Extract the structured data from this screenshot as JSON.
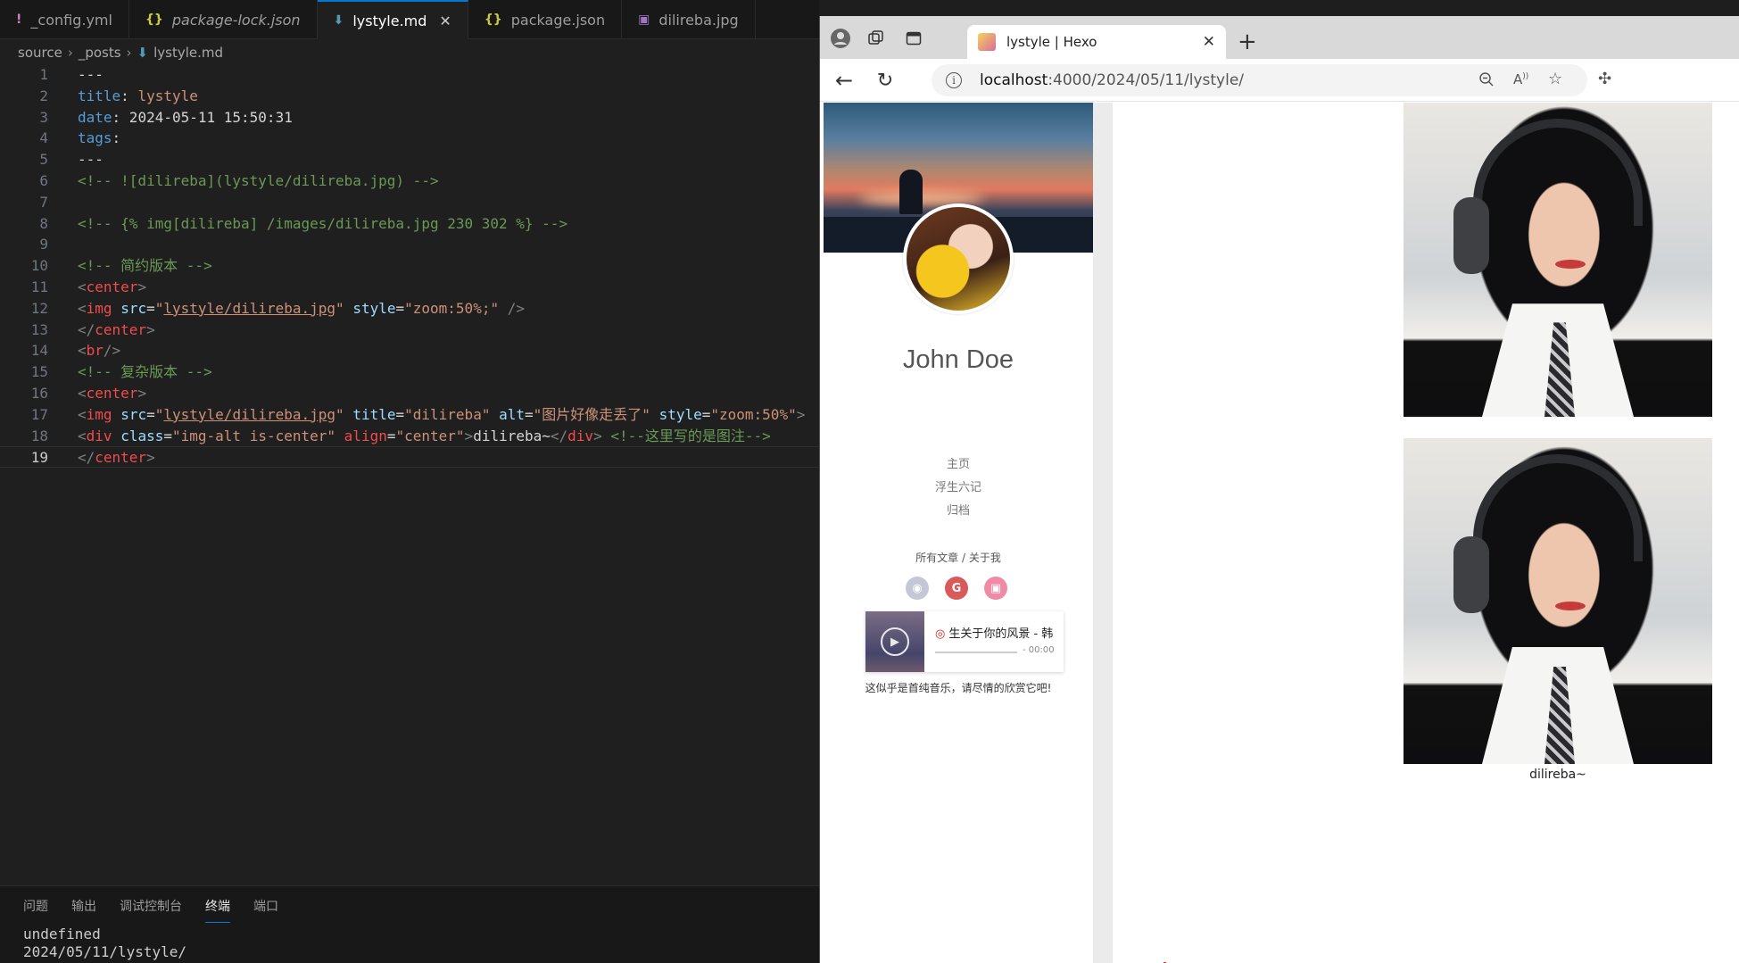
{
  "editor": {
    "tabs": [
      {
        "icon": "!",
        "icon_color": "#c586c0",
        "label": "_config.yml",
        "italic": false,
        "active": false
      },
      {
        "icon": "{}",
        "icon_color": "#cbcb41",
        "label": "package-lock.json",
        "italic": true,
        "active": false
      },
      {
        "icon": "⬇",
        "icon_color": "#519aba",
        "label": "lystyle.md",
        "italic": false,
        "active": true
      },
      {
        "icon": "{}",
        "icon_color": "#cbcb41",
        "label": "package.json",
        "italic": false,
        "active": false
      },
      {
        "icon": "▣",
        "icon_color": "#a074c4",
        "label": "dilireba.jpg",
        "italic": false,
        "active": false
      }
    ],
    "breadcrumb": [
      "source",
      "_posts",
      "lystyle.md"
    ],
    "lines": [
      {
        "n": "1",
        "t": "---"
      },
      {
        "n": "2",
        "t": "title: lystyle"
      },
      {
        "n": "3",
        "t": "date: 2024-05-11 15:50:31"
      },
      {
        "n": "4",
        "t": "tags:"
      },
      {
        "n": "5",
        "t": "---"
      },
      {
        "n": "6",
        "t": "<!-- ![dilireba](lystyle/dilireba.jpg) -->"
      },
      {
        "n": "7",
        "t": ""
      },
      {
        "n": "8",
        "t": "<!-- {% img[dilireba] /images/dilireba.jpg 230 302 %} -->"
      },
      {
        "n": "9",
        "t": ""
      },
      {
        "n": "10",
        "t": "<!-- 简约版本 -->"
      },
      {
        "n": "11",
        "t": "<center>"
      },
      {
        "n": "12",
        "t": "<img src=\"lystyle/dilireba.jpg\" style=\"zoom:50%;\" />"
      },
      {
        "n": "13",
        "t": "</center>"
      },
      {
        "n": "14",
        "t": "<br/>"
      },
      {
        "n": "15",
        "t": "<!-- 复杂版本 -->"
      },
      {
        "n": "16",
        "t": "<center>"
      },
      {
        "n": "17",
        "t": "<img src=\"lystyle/dilireba.jpg\" title=\"dilireba\" alt=\"图片好像走丢了\" style=\"zoom:50%\">"
      },
      {
        "n": "18",
        "t": "<div class=\"img-alt is-center\" align=\"center\">dilireba~</div> <!--这里写的是图注-->"
      },
      {
        "n": "19",
        "t": "</center>"
      }
    ],
    "current_line": "19",
    "panel_tabs": [
      "问题",
      "输出",
      "调试控制台",
      "终端",
      "端口"
    ],
    "active_panel_tab": "终端",
    "terminal_lines": [
      "undefined",
      "2024/05/11/lystyle/"
    ]
  },
  "browser": {
    "tab_title": "lystyle | Hexo",
    "url_host": "localhost",
    "url_rest": ":4000/2024/05/11/lystyle/",
    "icons": [
      "profile-icon",
      "collections-icon",
      "tab-actions-icon",
      "back-icon",
      "refresh-icon",
      "info-icon",
      "zoom-icon",
      "read-aloud-icon",
      "favorite-icon",
      "extensions-icon"
    ]
  },
  "blog": {
    "author": "John Doe",
    "nav": [
      "主页",
      "浮生六记",
      "归档"
    ],
    "secondary_links": "所有文章 / 关于我",
    "social": [
      {
        "name": "github-icon",
        "color": "#c4c8d6"
      },
      {
        "name": "gitee-icon",
        "color": "#d95a5a"
      },
      {
        "name": "bilibili-icon",
        "color": "#f08aa5"
      }
    ],
    "player": {
      "song": "生关于你的风景 - 韩",
      "time": "- 00:00"
    },
    "music_caption": "这似乎是首纯音乐，请尽情的欣赏它吧!",
    "image_caption": "dilireba~"
  }
}
